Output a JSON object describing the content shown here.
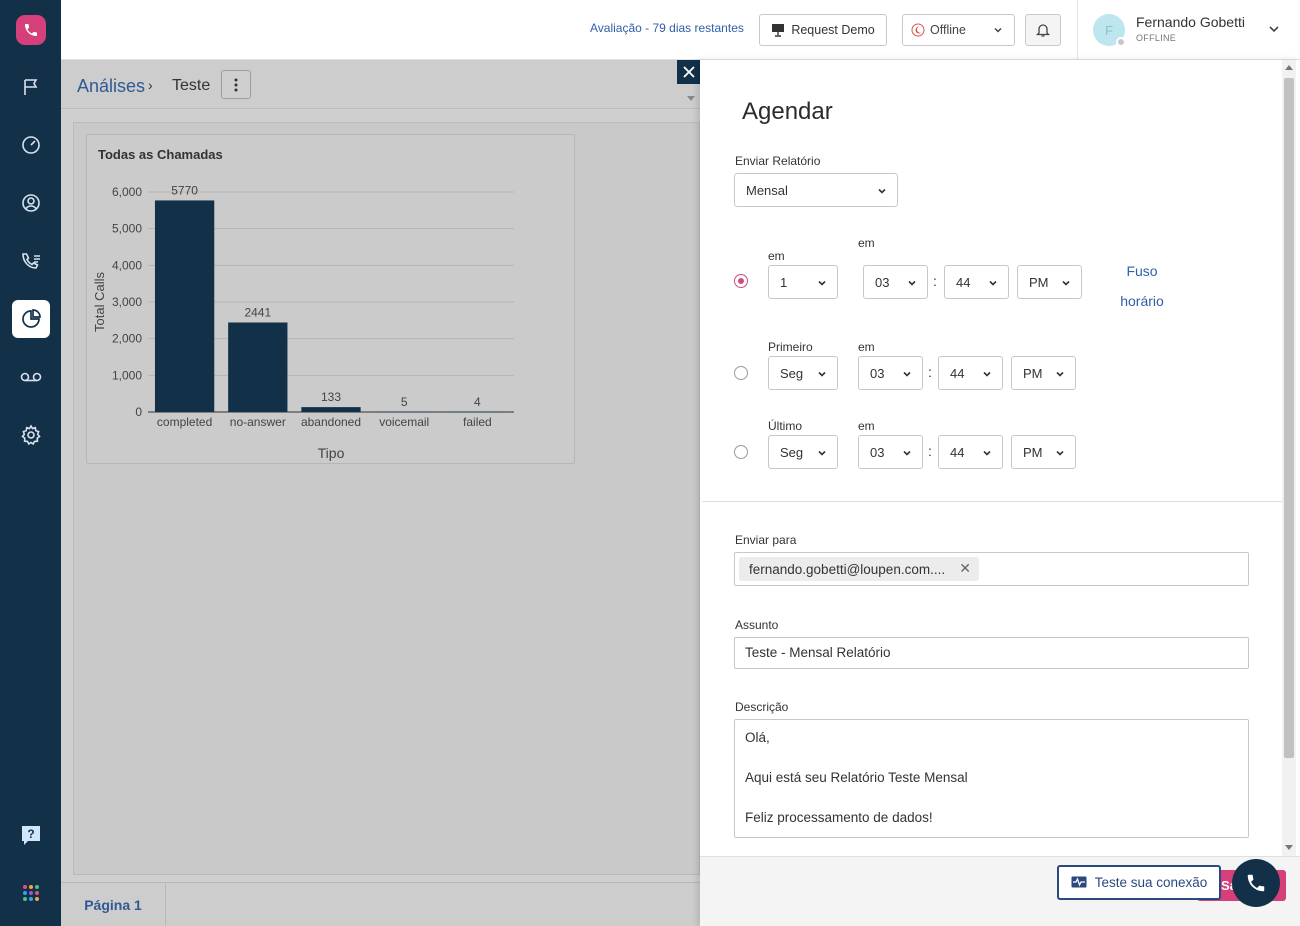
{
  "header": {
    "trial_text": "Avaliação - 79 dias restantes",
    "demo_label": "Request Demo",
    "status_label": "Offline",
    "user_name": "Fernando Gobetti",
    "user_status": "OFFLINE",
    "avatar_initial": "F"
  },
  "breadcrumb": {
    "root": "Análises",
    "current": "Teste"
  },
  "card": {
    "title": "Todas as Chamadas"
  },
  "footer": {
    "page_tab": "Página 1"
  },
  "chart_data": {
    "type": "bar",
    "title": "Todas as Chamadas",
    "xlabel": "Tipo",
    "ylabel": "Total Calls",
    "categories": [
      "completed",
      "no-answer",
      "abandoned",
      "voicemail",
      "failed"
    ],
    "values": [
      5770,
      2441,
      133,
      5,
      4
    ],
    "ylim": [
      0,
      6000
    ],
    "yticks": [
      0,
      1000,
      2000,
      3000,
      4000,
      5000,
      6000
    ],
    "ytick_labels": [
      "0",
      "1,000",
      "2,000",
      "3,000",
      "4,000",
      "5,000",
      "6,000"
    ],
    "grid": true,
    "bar_color": "#123149"
  },
  "schedule": {
    "title": "Agendar",
    "send_report_label": "Enviar Relatório",
    "frequency_value": "Mensal",
    "em_label": "em",
    "row1": {
      "label": "em",
      "day": "1",
      "hour": "03",
      "minute": "44",
      "ampm": "PM"
    },
    "row2": {
      "label": "Primeiro",
      "day": "Seg",
      "hour": "03",
      "minute": "44",
      "ampm": "PM"
    },
    "row3": {
      "label": "Último",
      "day": "Seg",
      "hour": "03",
      "minute": "44",
      "ampm": "PM"
    },
    "colon": ":",
    "tz_line1": "Fuso",
    "tz_line2": "horário",
    "send_to_label": "Enviar para",
    "recipient": "fernando.gobetti@loupen.com....",
    "subject_label": "Assunto",
    "subject_value": "Teste - Mensal Relatório",
    "description_label": "Descrição",
    "description_lines": [
      "Olá,",
      "",
      "Aqui está seu Relatório Teste Mensal",
      "",
      "Feliz processamento de dados!"
    ],
    "save_label": "Sa",
    "test_connection_label": "Teste sua conexão"
  },
  "colors": {
    "rail": "#123149",
    "accent": "#d6407a",
    "link": "#2f5fa8"
  }
}
